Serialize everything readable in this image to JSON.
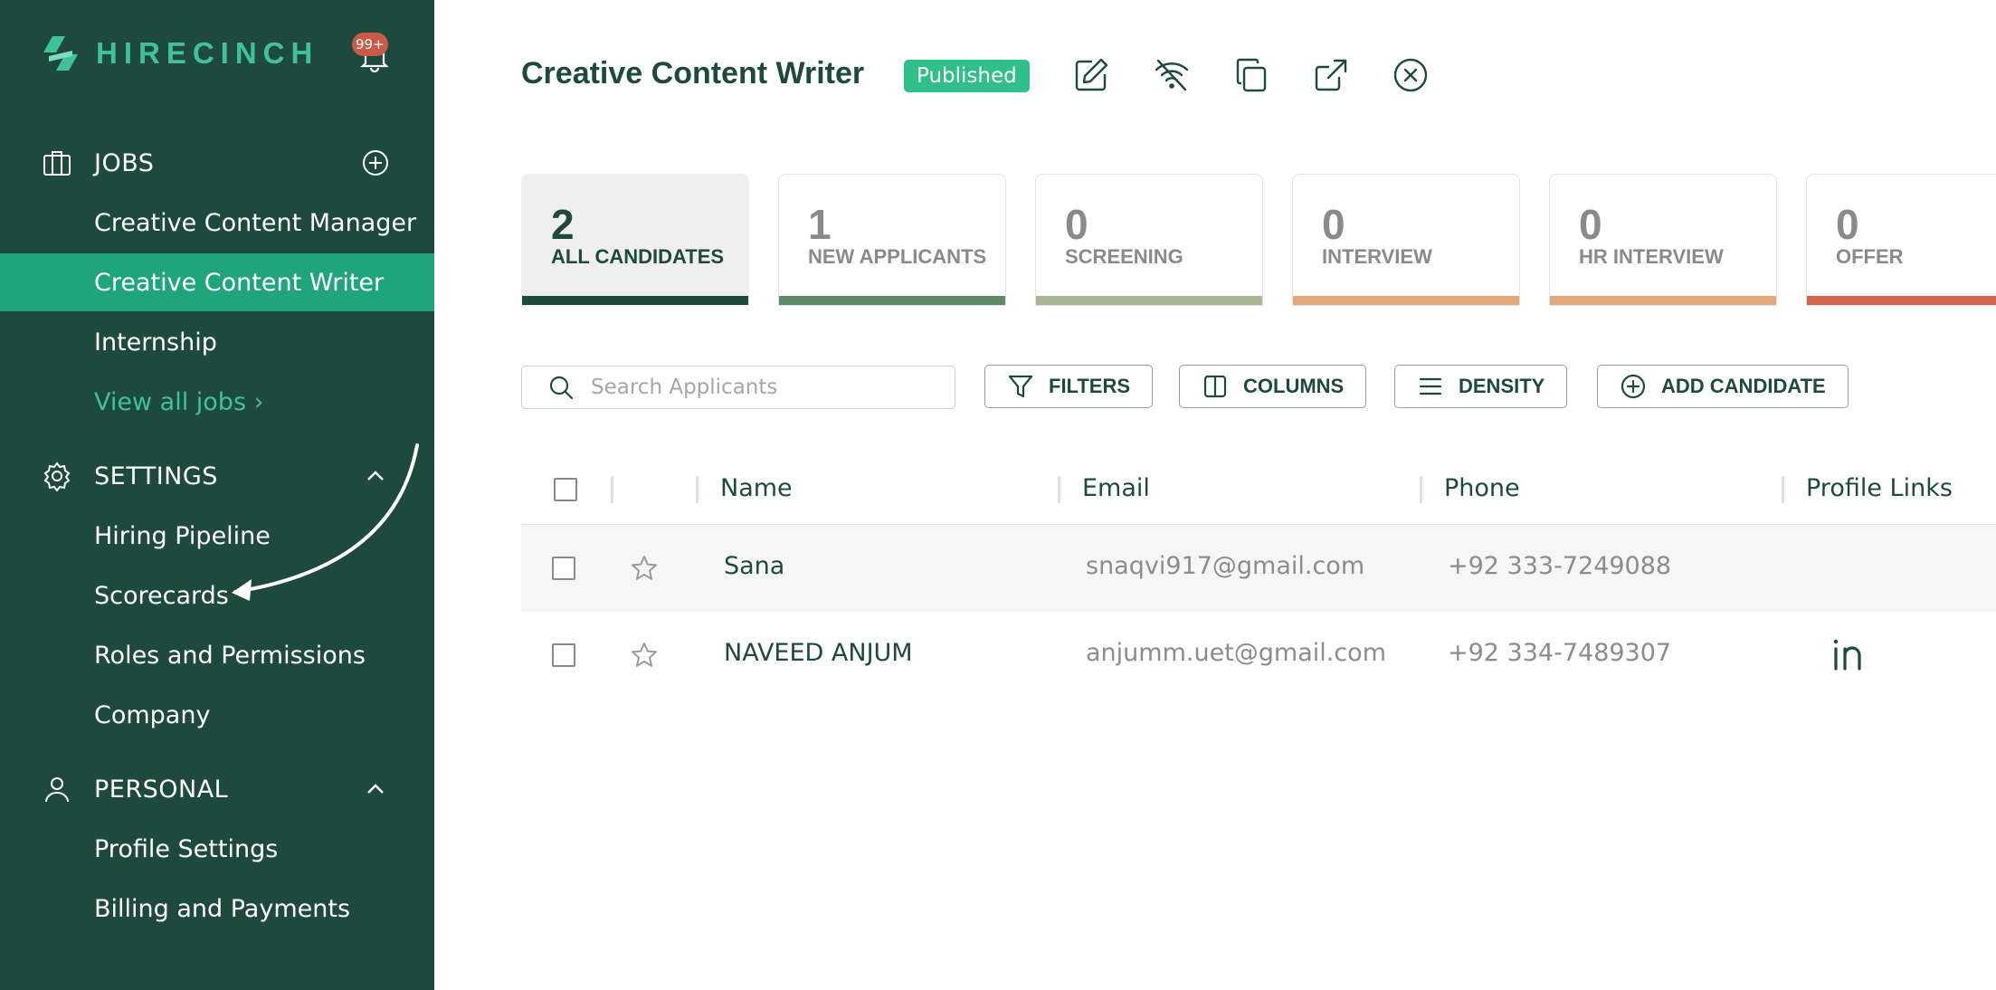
{
  "brand": {
    "name": "HIRECINCH",
    "notification_count": "99+",
    "colors": {
      "sidebar": "#1d4a3c",
      "accent": "#1fa57e"
    }
  },
  "sidebar": {
    "jobs": {
      "label": "JOBS",
      "items": [
        "Creative Content Manager",
        "Creative Content Writer",
        "Internship"
      ],
      "active_item": "Creative Content Writer",
      "view_all": "View all jobs ›"
    },
    "settings": {
      "label": "SETTINGS",
      "items": [
        "Hiring Pipeline",
        "Scorecards",
        "Roles and Permissions",
        "Company"
      ]
    },
    "personal": {
      "label": "PERSONAL",
      "items": [
        "Profile Settings",
        "Billing and Payments"
      ]
    }
  },
  "job": {
    "title": "Creative Content Writer",
    "status": "Published",
    "actions": [
      "edit-icon",
      "unpublish-wifi-off-icon",
      "duplicate-icon",
      "open-external-icon",
      "close-job-icon"
    ]
  },
  "stages": [
    {
      "count": "2",
      "label": "ALL CANDIDATES",
      "color": "#1d4a3c",
      "active": true
    },
    {
      "count": "1",
      "label": "NEW APPLICANTS",
      "color": "#5e8a6a"
    },
    {
      "count": "0",
      "label": "SCREENING",
      "color": "#a8b594"
    },
    {
      "count": "0",
      "label": "INTERVIEW",
      "color": "#e3a878"
    },
    {
      "count": "0",
      "label": "HR INTERVIEW",
      "color": "#e3a878"
    },
    {
      "count": "0",
      "label": "OFFER",
      "color": "#d2654a"
    }
  ],
  "toolbar": {
    "search_placeholder": "Search Applicants",
    "filters": "FILTERS",
    "columns": "COLUMNS",
    "density": "DENSITY",
    "add_candidate": "ADD CANDIDATE"
  },
  "table": {
    "headers": {
      "name": "Name",
      "email": "Email",
      "phone": "Phone",
      "links": "Profile Links"
    },
    "rows": [
      {
        "name": "Sana",
        "email": "snaqvi917@gmail.com",
        "phone": "+92 333-7249088",
        "links": []
      },
      {
        "name": "NAVEED ANJUM",
        "email": "anjumm.uet@gmail.com",
        "phone": "+92 334-7489307",
        "links": [
          "linkedin-icon"
        ]
      }
    ]
  }
}
